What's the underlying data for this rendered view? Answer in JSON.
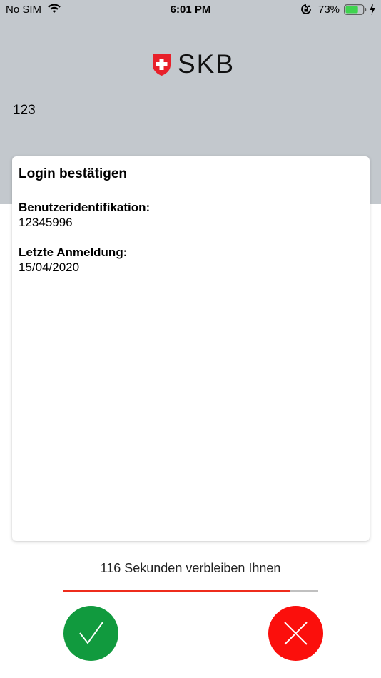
{
  "status_bar": {
    "carrier": "No SIM",
    "time": "6:01 PM",
    "battery_percent": "73%",
    "battery_level": 0.73
  },
  "header": {
    "brand": "SKB",
    "account_number": "123"
  },
  "card": {
    "title": "Login bestätigen",
    "fields": [
      {
        "label": "Benutzeridentifikation:",
        "value": "12345996"
      },
      {
        "label": "Letzte Anmeldung:",
        "value": "15/04/2020"
      }
    ]
  },
  "countdown": {
    "text": "116 Sekunden verbleiben Ihnen",
    "remaining_fraction": 0.89
  },
  "actions": {
    "confirm_icon": "checkmark-icon",
    "reject_icon": "x-icon"
  },
  "colors": {
    "header_bg": "#c3c8cd",
    "confirm_green": "#119a3e",
    "reject_red": "#fb0f0c",
    "progress_red": "#ee2c1c",
    "battery_green": "#3fd34f",
    "swiss_red": "#e8202a"
  }
}
